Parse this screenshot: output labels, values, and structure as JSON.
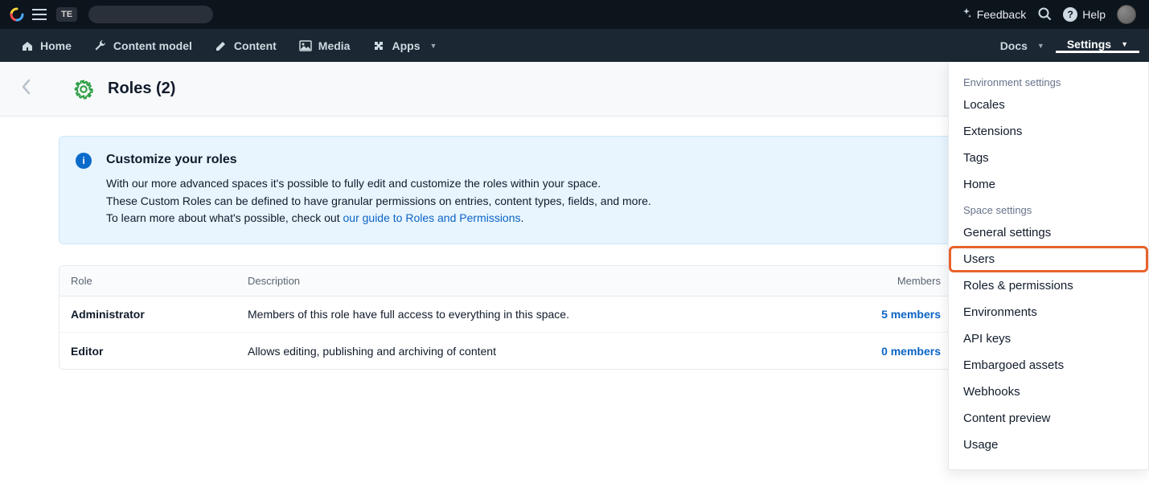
{
  "topbar": {
    "org_badge": "TE",
    "feedback": "Feedback",
    "help": "Help"
  },
  "nav": {
    "home": "Home",
    "content_model": "Content model",
    "content": "Content",
    "media": "Media",
    "apps": "Apps",
    "docs": "Docs",
    "settings": "Settings"
  },
  "page": {
    "title": "Roles (2)"
  },
  "banner": {
    "title": "Customize your roles",
    "line1": "With our more advanced spaces it's possible to fully edit and customize the roles within your space.",
    "line2": "These Custom Roles can be defined to have granular permissions on entries, content types, fields, and more.",
    "line3_prefix": "To learn more about what's possible, check out ",
    "link_text": "our guide to Roles and Permissions",
    "line3_suffix": "."
  },
  "table": {
    "headers": {
      "role": "Role",
      "description": "Description",
      "members": "Members"
    },
    "rows": [
      {
        "name": "Administrator",
        "description": "Members of this role have full access to everything in this space.",
        "members": "5 members"
      },
      {
        "name": "Editor",
        "description": "Allows editing, publishing and archiving of content",
        "members": "0 members"
      }
    ]
  },
  "dropdown": {
    "env_header": "Environment settings",
    "env_items": [
      "Locales",
      "Extensions",
      "Tags",
      "Home"
    ],
    "space_header": "Space settings",
    "space_items": [
      "General settings",
      "Users",
      "Roles & permissions",
      "Environments",
      "API keys",
      "Embargoed assets",
      "Webhooks",
      "Content preview",
      "Usage"
    ],
    "highlight": "Users"
  }
}
